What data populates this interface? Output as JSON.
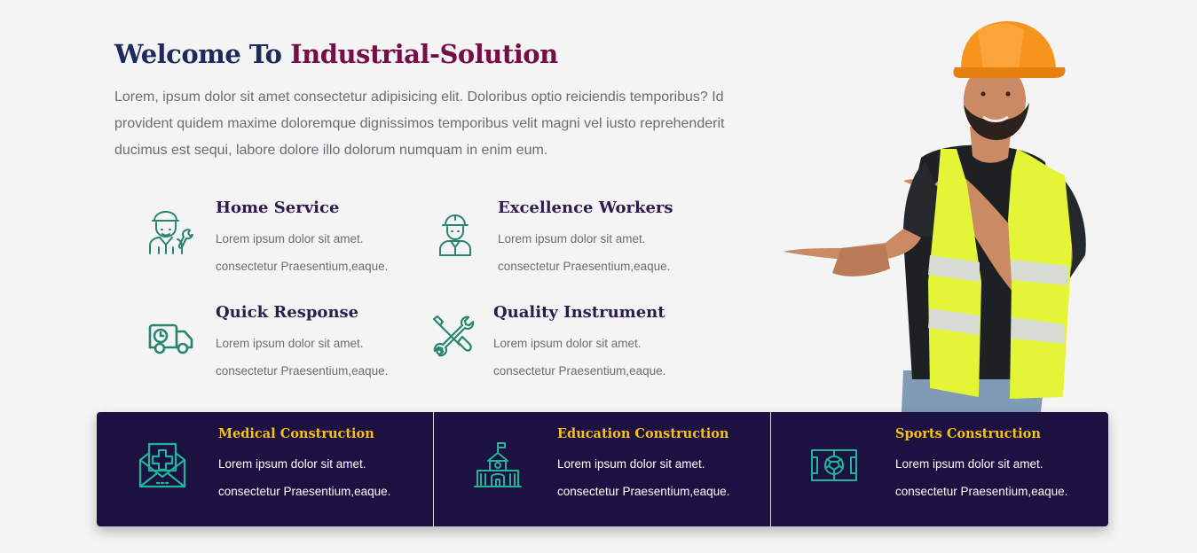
{
  "intro": {
    "title_prefix": "Welcome To",
    "title_accent": "Industrial-Solution",
    "paragraph": "Lorem, ipsum dolor sit amet consectetur adipisicing elit. Doloribus optio reiciendis temporibus? Id provident quidem maxime doloremque dignissimos temporibus velit magni vel iusto reprehenderit ducimus est sequi, labore dolore illo dolorum numquam in enim eum."
  },
  "features": [
    {
      "title": "Home Service",
      "line1": "Lorem ipsum dolor sit amet.",
      "line2": "consectetur Praesentium,eaque.",
      "icon": "mechanic-icon"
    },
    {
      "title": "Excellence Workers",
      "line1": "Lorem ipsum dolor sit amet.",
      "line2": "consectetur Praesentium,eaque.",
      "icon": "engineer-icon"
    },
    {
      "title": "Quick Response",
      "line1": "Lorem ipsum dolor sit amet.",
      "line2": "consectetur Praesentium,eaque.",
      "icon": "delivery-truck-icon"
    },
    {
      "title": "Quality Instrument",
      "line1": "Lorem ipsum dolor sit amet.",
      "line2": "consectetur Praesentium,eaque.",
      "icon": "wrench-tools-icon"
    }
  ],
  "services": [
    {
      "title": "Medical Construction",
      "line1": "Lorem ipsum dolor sit amet.",
      "line2": "consectetur Praesentium,eaque.",
      "icon": "medical-envelope-icon"
    },
    {
      "title": "Education Construction",
      "line1": "Lorem ipsum dolor sit amet.",
      "line2": "consectetur Praesentium,eaque.",
      "icon": "school-building-icon"
    },
    {
      "title": "Sports Construction",
      "line1": "Lorem ipsum dolor sit amet.",
      "line2": "consectetur Praesentium,eaque.",
      "icon": "football-field-icon"
    }
  ],
  "colors": {
    "heading": "#1c2a5c",
    "accent": "#770d48",
    "feature_icon": "#2a8570",
    "band_background": "#1c1140",
    "band_title": "#f6c014",
    "band_icon": "#21b59b"
  },
  "hero_image": "construction-worker-pointing"
}
